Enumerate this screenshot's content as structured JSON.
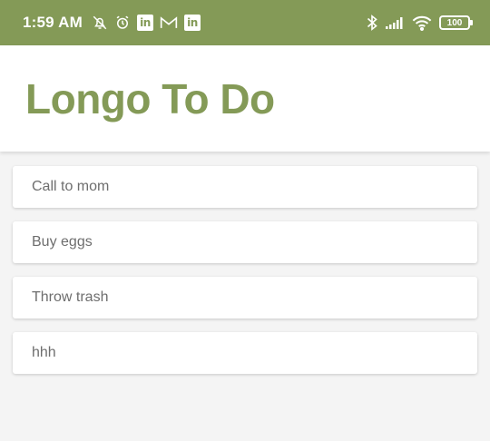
{
  "status_bar": {
    "time": "1:59 AM",
    "left_icons": [
      "notifications-off-icon",
      "alarm-icon",
      "linkedin-icon",
      "gmail-icon",
      "linkedin-icon"
    ],
    "right_icons": [
      "bluetooth-icon",
      "signal-icon",
      "wifi-icon"
    ],
    "battery": "100",
    "color": "#849a57"
  },
  "header": {
    "title": "Longo To Do",
    "accent": "#849a57"
  },
  "todos": [
    {
      "text": "Call to mom"
    },
    {
      "text": "Buy eggs"
    },
    {
      "text": "Throw trash"
    },
    {
      "text": "hhh"
    }
  ]
}
